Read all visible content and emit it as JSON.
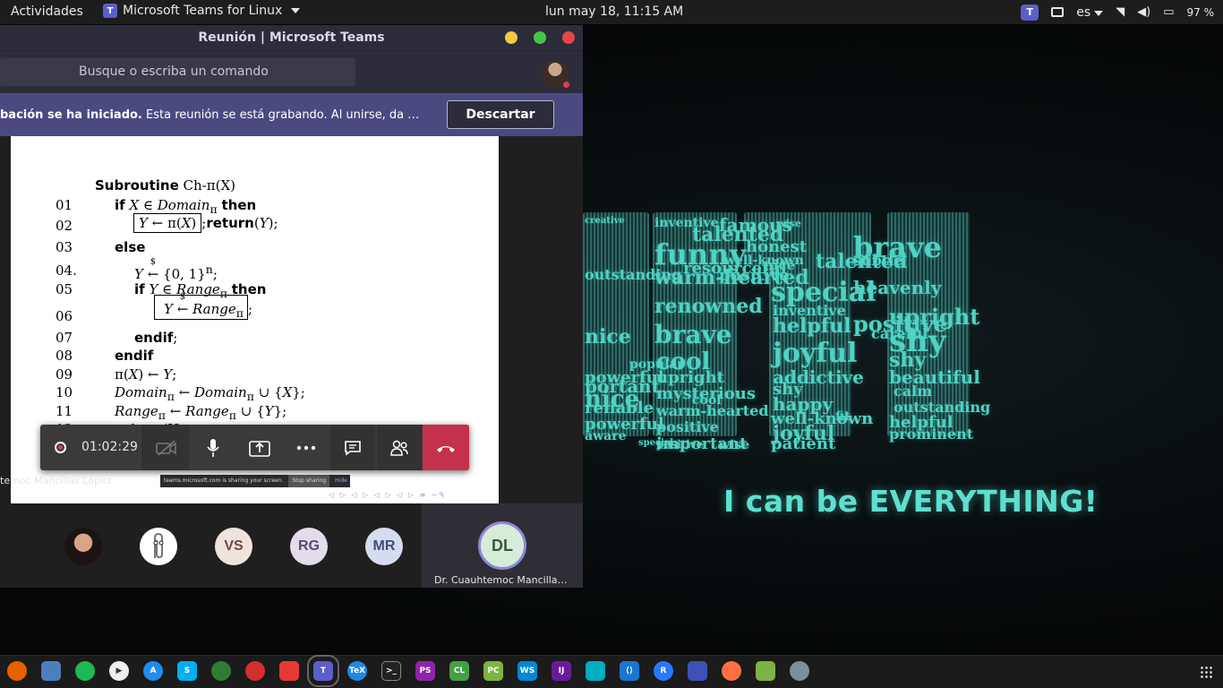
{
  "topbar": {
    "activities": "Actividades",
    "app_name": "Microsoft Teams for Linux",
    "clock": "lun may 18, 11:15 AM",
    "keyboard_layout": "es",
    "battery_percent": "97 %"
  },
  "window": {
    "title": "Reunión | Microsoft Teams",
    "search_placeholder": "Busque o escriba un comando"
  },
  "banner": {
    "bold_text": "bación se ha iniciado.",
    "text": " Esta reunión se está grabando. Al unirse, da su co...",
    "dismiss_label": "Descartar"
  },
  "slide": {
    "title_kw": "Subroutine",
    "title_rest": " Ch-π(X)",
    "lines": [
      {
        "no": "01",
        "text": "if X ∈ Domain_π then"
      },
      {
        "no": "02",
        "text": "Y ← π(X);return(Y);"
      },
      {
        "no": "03",
        "text": "else"
      },
      {
        "no": "04.",
        "text": "Y ←$ {0,1}ⁿ;"
      },
      {
        "no": "05",
        "text": "if Y ∈ Range_π then"
      },
      {
        "no": "06",
        "text": "Y ←$ Range_π;"
      },
      {
        "no": "07",
        "text": "endif;"
      },
      {
        "no": "08",
        "text": "endif"
      },
      {
        "no": "09",
        "text": "π(X) ← Y;"
      },
      {
        "no": "10",
        "text": "Domain_π ← Domain_π ∪ {X};"
      },
      {
        "no": "11",
        "text": "Range_π ← Range_π ∪ {Y};"
      },
      {
        "no": "12",
        "text": "return(Y);"
      }
    ],
    "presenter": "temoc Mancillas López",
    "share_notice": "teams.microsoft.com is sharing your screen.",
    "share_stop": "Stop sharing",
    "share_hide": "Hide"
  },
  "call_controls": {
    "timer": "01:02:29"
  },
  "participants": [
    {
      "initials": "",
      "kind": "photo"
    },
    {
      "initials": "",
      "kind": "clippy"
    },
    {
      "initials": "VS",
      "bg": "#f0e2dc",
      "fg": "#6b4a40"
    },
    {
      "initials": "RG",
      "bg": "#e3dcec",
      "fg": "#5a4a6e"
    },
    {
      "initials": "MR",
      "bg": "#d5dcef",
      "fg": "#3f4e7a"
    }
  ],
  "active_speaker": {
    "initials": "DL",
    "name": "Dr. Cuauhtemoc Mancillas..."
  },
  "wallpaper": {
    "slogan": "I can be EVERYTHING!",
    "words": [
      "creative",
      "inventive",
      "talented",
      "famous",
      "honest",
      "wise",
      "brave",
      "funny",
      "resourceful",
      "well-known",
      "nice",
      "talented",
      "outstanding",
      "warm-hearted",
      "positive",
      "subtle",
      "special",
      "heavenly",
      "upright",
      "renowned",
      "inventive",
      "helpful",
      "positive",
      "brave",
      "careful",
      "shy",
      "joyful",
      "nice",
      "cool",
      "shy",
      "addictive",
      "beautiful",
      "powerful",
      "upright",
      "mysterious",
      "calm",
      "warm-hearted",
      "shy",
      "happy",
      "outstanding",
      "nice",
      "well-known",
      "fit",
      "helpful",
      "positive",
      "joyful",
      "patient",
      "powerful",
      "important",
      "prominent",
      "portant",
      "reliable",
      "positive",
      "wise",
      "cool",
      "popular",
      "aware",
      "special"
    ]
  },
  "colors": {
    "teams_purple": "#5b5fc7",
    "hangup_red": "#c4314b",
    "wallpaper_teal": "#4fd3c4"
  }
}
